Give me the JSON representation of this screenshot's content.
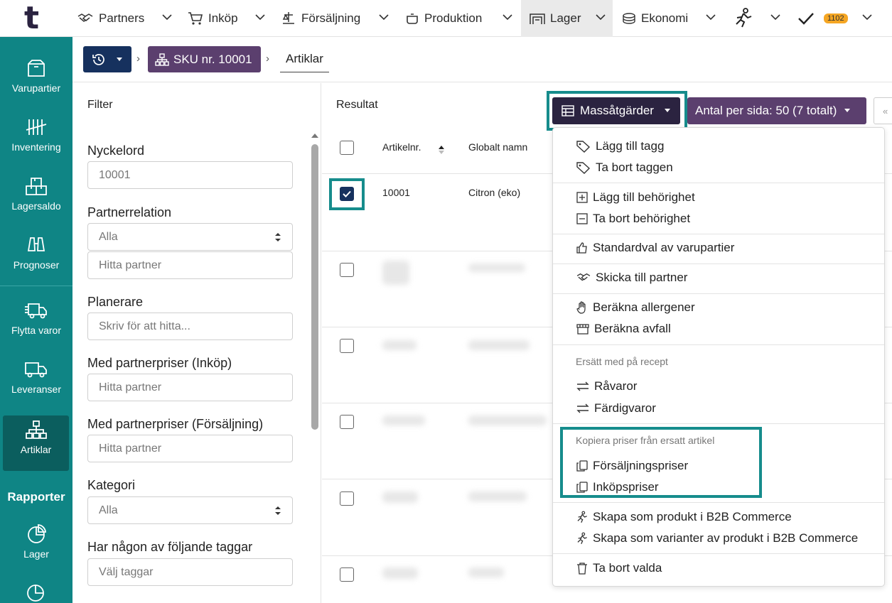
{
  "logo": "t",
  "nav": {
    "items": [
      {
        "label": "Partners",
        "icon": "handshake-icon"
      },
      {
        "label": "Inköp",
        "icon": "cart-icon"
      },
      {
        "label": "Försäljning",
        "icon": "scale-icon"
      },
      {
        "label": "Produktion",
        "icon": "pot-icon"
      },
      {
        "label": "Lager",
        "icon": "warehouse-icon"
      },
      {
        "label": "Ekonomi",
        "icon": "coins-icon"
      }
    ],
    "tasks_count": "1102"
  },
  "sidebar": {
    "items": [
      {
        "label": "Varupartier",
        "icon": "box-icon"
      },
      {
        "label": "Inventering",
        "icon": "tally-icon"
      },
      {
        "label": "Lagersaldo",
        "icon": "boxes-icon"
      },
      {
        "label": "Prognoser",
        "icon": "binoculars-icon"
      },
      {
        "label": "Flytta varor",
        "icon": "truck-move-icon"
      },
      {
        "label": "Leveranser",
        "icon": "truck-icon"
      },
      {
        "label": "Artiklar",
        "icon": "hierarchy-icon"
      }
    ],
    "reports_heading": "Rapporter",
    "report_items": [
      {
        "label": "Lager",
        "icon": "pie-chart-icon"
      }
    ]
  },
  "breadcrumb": {
    "sku": "SKU nr. 10001",
    "current": "Artiklar"
  },
  "filter": {
    "title": "Filter",
    "fields": {
      "keyword_label": "Nyckelord",
      "keyword_value": "10001",
      "partnerrel_label": "Partnerrelation",
      "partnerrel_value": "Alla",
      "partnerrel_search_placeholder": "Hitta partner",
      "planner_label": "Planerare",
      "planner_placeholder": "Skriv för att hitta...",
      "purchase_prices_label": "Med partnerpriser (Inköp)",
      "purchase_prices_placeholder": "Hitta partner",
      "sales_prices_label": "Med partnerpriser (Försäljning)",
      "sales_prices_placeholder": "Hitta partner",
      "category_label": "Kategori",
      "category_value": "Alla",
      "tags_label": "Har någon av följande taggar",
      "tags_placeholder": "Välj taggar"
    }
  },
  "results": {
    "title": "Resultat",
    "mass_actions_label": "Massåtgärder",
    "per_page_label": "Antal per sida: 50 (7 totalt)",
    "prev_label": "«",
    "columns": [
      "Artikelnr.",
      "Globalt namn"
    ],
    "rows": [
      {
        "artikelnr": "10001",
        "name": "Citron (eko)",
        "checked": true
      }
    ]
  },
  "menu": {
    "add_tag": "Lägg till tagg",
    "remove_tag": "Ta bort taggen",
    "add_permission": "Lägg till behörighet",
    "remove_permission": "Ta bort behörighet",
    "default_batches": "Standardval av varupartier",
    "send_to_partner": "Skicka till partner",
    "calc_allergens": "Beräkna allergener",
    "calc_waste": "Beräkna avfall",
    "replace_heading": "Ersätt med på recept",
    "raw_materials": "Råvaror",
    "finished_goods": "Färdigvaror",
    "copy_prices_heading": "Kopiera priser från ersatt artikel",
    "sales_prices": "Försäljningspriser",
    "purchase_prices": "Inköpspriser",
    "create_product_b2b": "Skapa som produkt i B2B Commerce",
    "create_variants_b2b": "Skapa som varianter av produkt i B2B Commerce",
    "delete_selected": "Ta bort valda"
  },
  "colors": {
    "sidebar": "#0f8585",
    "sidebar_active": "#0b5e5e",
    "navy": "#16315e",
    "purple": "#5b3f6e",
    "dark": "#2b2340",
    "highlight": "#168c8c",
    "badge": "#f5a623"
  }
}
